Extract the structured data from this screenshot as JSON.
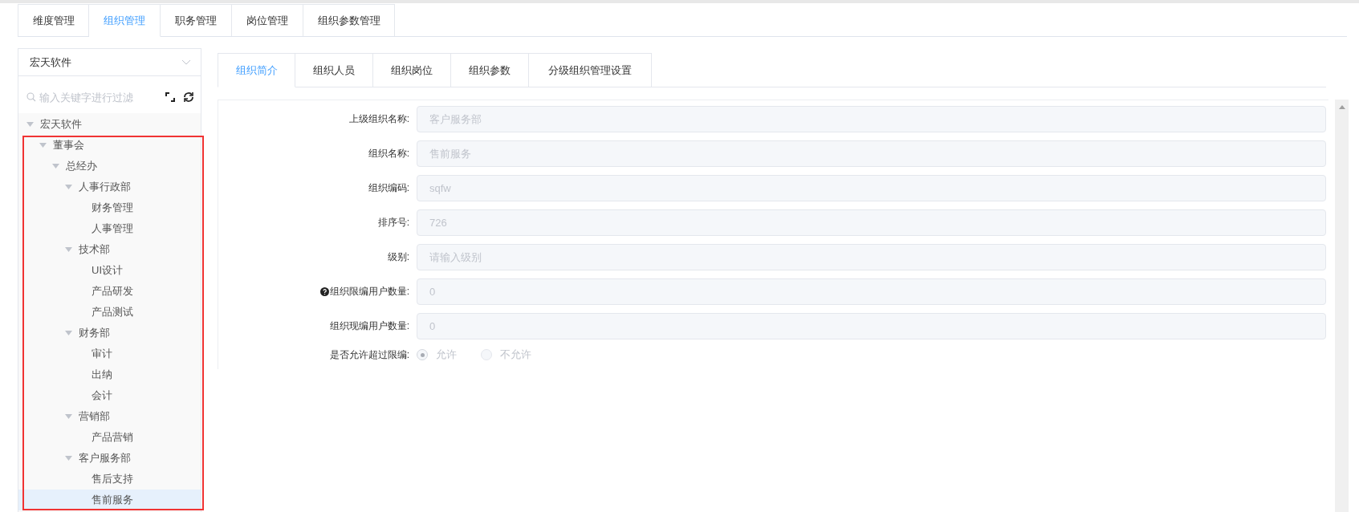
{
  "main_tabs": [
    {
      "label": "维度管理",
      "selected": false
    },
    {
      "label": "组织管理",
      "selected": true
    },
    {
      "label": "职务管理",
      "selected": false
    },
    {
      "label": "岗位管理",
      "selected": false
    },
    {
      "label": "组织参数管理",
      "selected": false
    }
  ],
  "sidebar": {
    "select": {
      "value": "宏天软件"
    },
    "search": {
      "placeholder": "输入关键字进行过滤"
    },
    "tree": [
      {
        "label": "宏天软件",
        "expanded": true,
        "selected": false,
        "children": [
          {
            "label": "董事会",
            "expanded": true,
            "selected": false,
            "children": [
              {
                "label": "总经办",
                "expanded": true,
                "selected": false,
                "children": [
                  {
                    "label": "人事行政部",
                    "expanded": true,
                    "selected": false,
                    "children": [
                      {
                        "label": "财务管理",
                        "selected": false
                      },
                      {
                        "label": "人事管理",
                        "selected": false
                      }
                    ]
                  },
                  {
                    "label": "技术部",
                    "expanded": true,
                    "selected": false,
                    "children": [
                      {
                        "label": "UI设计",
                        "selected": false
                      },
                      {
                        "label": "产品研发",
                        "selected": false
                      },
                      {
                        "label": "产品测试",
                        "selected": false
                      }
                    ]
                  },
                  {
                    "label": "财务部",
                    "expanded": true,
                    "selected": false,
                    "children": [
                      {
                        "label": "审计",
                        "selected": false
                      },
                      {
                        "label": "出纳",
                        "selected": false
                      },
                      {
                        "label": "会计",
                        "selected": false
                      }
                    ]
                  },
                  {
                    "label": "营销部",
                    "expanded": true,
                    "selected": false,
                    "children": [
                      {
                        "label": "产品营销",
                        "selected": false
                      }
                    ]
                  },
                  {
                    "label": "客户服务部",
                    "expanded": true,
                    "selected": false,
                    "children": [
                      {
                        "label": "售后支持",
                        "selected": false
                      },
                      {
                        "label": "售前服务",
                        "selected": true
                      }
                    ]
                  }
                ]
              }
            ]
          }
        ]
      }
    ]
  },
  "detail_tabs": [
    {
      "label": "组织简介",
      "selected": true
    },
    {
      "label": "组织人员",
      "selected": false
    },
    {
      "label": "组织岗位",
      "selected": false
    },
    {
      "label": "组织参数",
      "selected": false
    },
    {
      "label": "分级组织管理设置",
      "selected": false
    }
  ],
  "form": {
    "fields": [
      {
        "label": "上级组织名称:",
        "value": "客户服务部",
        "help": false
      },
      {
        "label": "组织名称:",
        "value": "售前服务",
        "help": false
      },
      {
        "label": "组织编码:",
        "value": "sqfw",
        "help": false
      },
      {
        "label": "排序号:",
        "value": "726",
        "help": false
      },
      {
        "label": "级别:",
        "placeholder": "请输入级别",
        "help": false
      },
      {
        "label": "组织限编用户数量:",
        "value": "0",
        "help": true
      },
      {
        "label": "组织现编用户数量:",
        "value": "0",
        "help": false
      }
    ],
    "radio": {
      "label": "是否允许超过限编:",
      "disabled": true,
      "options": [
        {
          "label": "允许",
          "selected": true
        },
        {
          "label": "不允许",
          "selected": false
        }
      ]
    }
  }
}
